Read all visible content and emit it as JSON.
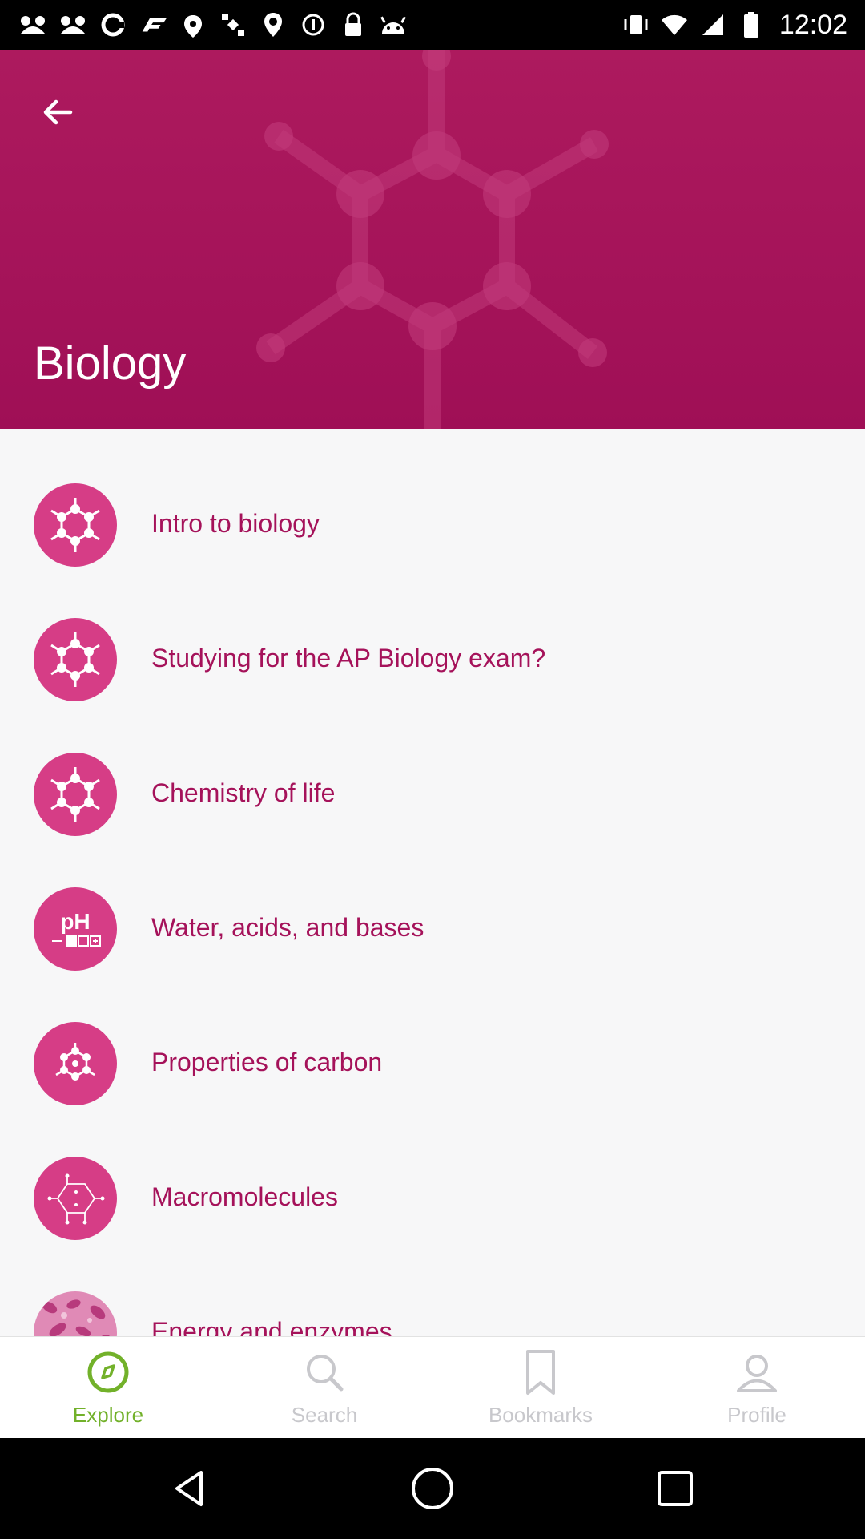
{
  "status_bar": {
    "time": "12:02",
    "icons": [
      "notification-icon",
      "notification-icon",
      "c-icon",
      "f1-icon",
      "fake-gps-icon",
      "satellite-icon",
      "location-icon",
      "info-icon",
      "lock-icon",
      "android-icon",
      "vibrate-icon",
      "wifi-icon",
      "signal-icon",
      "battery-icon"
    ]
  },
  "header": {
    "title": "Biology",
    "background_color": "#a5125a",
    "back_icon": "arrow-left-icon"
  },
  "topics": [
    {
      "label": "Intro to biology",
      "icon": "molecule-icon"
    },
    {
      "label": "Studying for the AP Biology exam?",
      "icon": "molecule-icon"
    },
    {
      "label": "Chemistry of life",
      "icon": "molecule-icon"
    },
    {
      "label": "Water, acids, and bases",
      "icon": "ph-icon",
      "icon_text": "pH"
    },
    {
      "label": "Properties of carbon",
      "icon": "carbon-ring-icon"
    },
    {
      "label": "Macromolecules",
      "icon": "glucose-structure-icon"
    },
    {
      "label": "Energy and enzymes",
      "icon": "cell-tissue-image"
    }
  ],
  "bottom_nav": {
    "items": [
      {
        "label": "Explore",
        "icon": "compass-icon",
        "active": true
      },
      {
        "label": "Search",
        "icon": "search-icon",
        "active": false
      },
      {
        "label": "Bookmarks",
        "icon": "bookmark-icon",
        "active": false
      },
      {
        "label": "Profile",
        "icon": "person-icon",
        "active": false
      }
    ],
    "active_color": "#72b12a",
    "inactive_color": "#c8c8cc"
  },
  "system_nav": {
    "buttons": [
      "back-triangle-icon",
      "home-circle-icon",
      "recents-square-icon"
    ]
  }
}
